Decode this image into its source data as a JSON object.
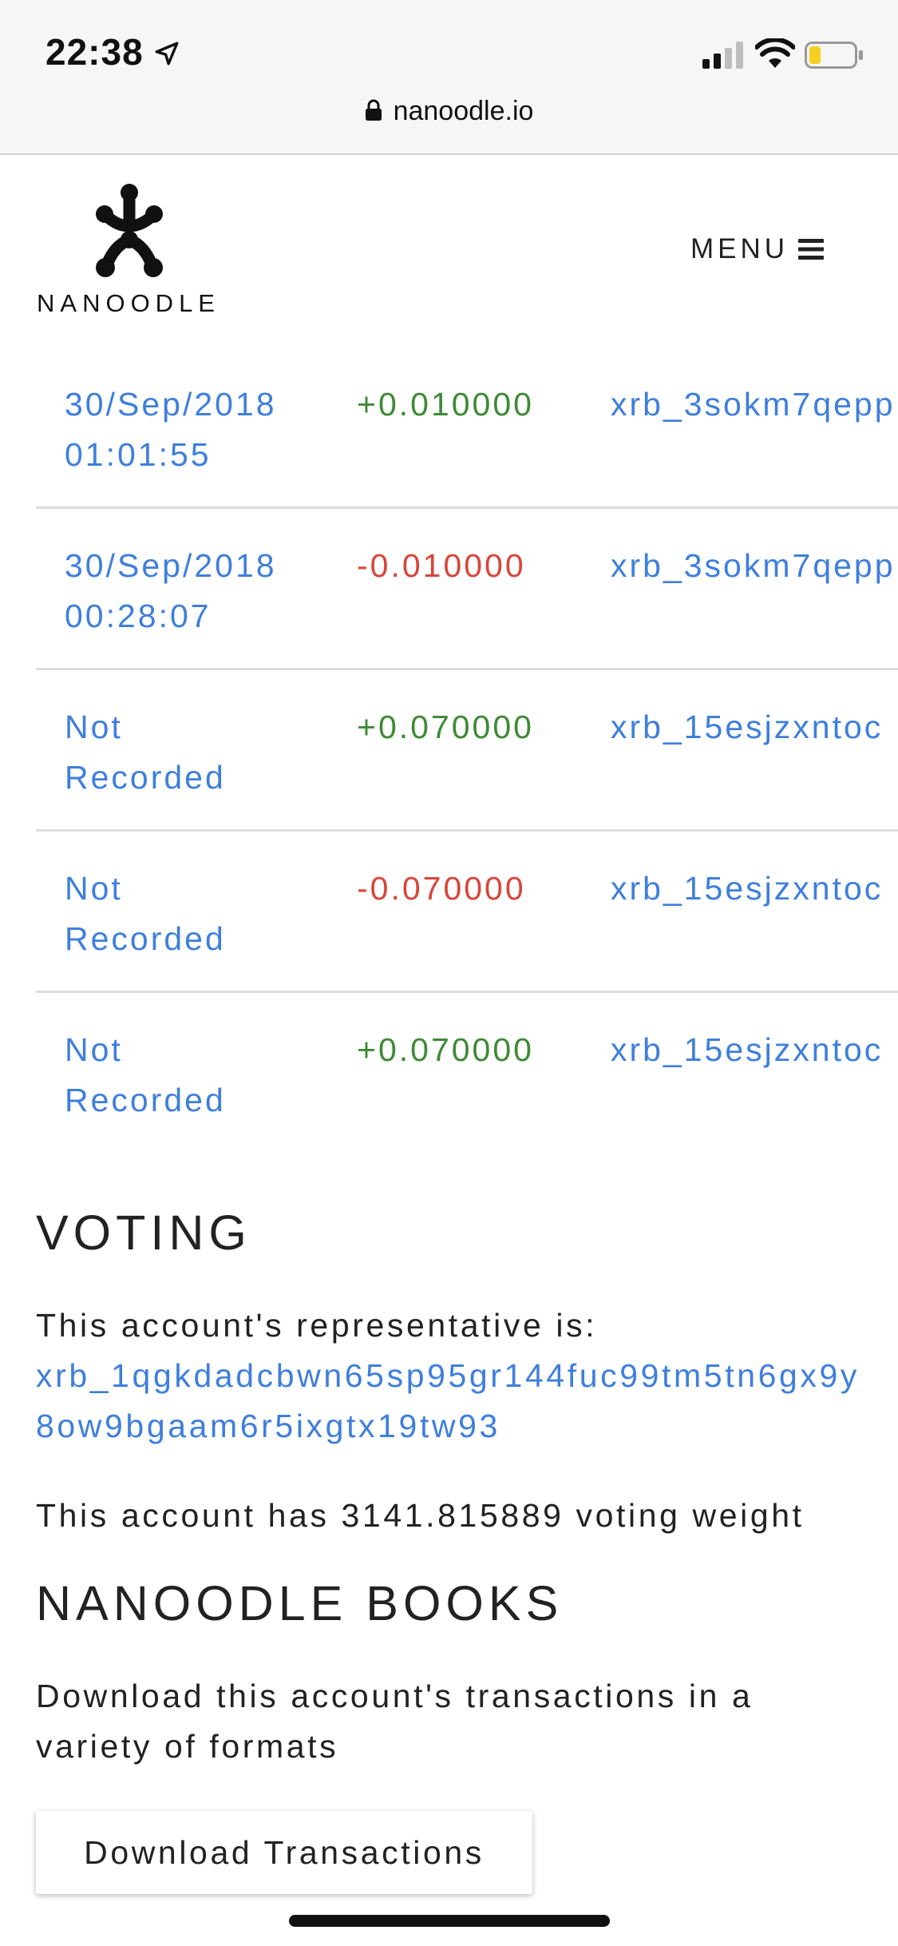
{
  "status_bar": {
    "time": "22:38"
  },
  "browser": {
    "url": "nanoodle.io"
  },
  "header": {
    "logo_text": "NANOODLE",
    "menu_label": "MENU"
  },
  "transactions": [
    {
      "date_line1": "30/Sep/2018",
      "date_line2": "01:01:55",
      "amount": "+0.010000",
      "direction": "positive",
      "account": "xrb_3sokm7qepp"
    },
    {
      "date_line1": "30/Sep/2018",
      "date_line2": "00:28:07",
      "amount": "-0.010000",
      "direction": "negative",
      "account": "xrb_3sokm7qepp"
    },
    {
      "date_line1": "Not",
      "date_line2": "Recorded",
      "amount": "+0.070000",
      "direction": "positive",
      "account": "xrb_15esjzxntoc"
    },
    {
      "date_line1": "Not",
      "date_line2": "Recorded",
      "amount": "-0.070000",
      "direction": "negative",
      "account": "xrb_15esjzxntoc"
    },
    {
      "date_line1": "Not",
      "date_line2": "Recorded",
      "amount": "+0.070000",
      "direction": "positive",
      "account": "xrb_15esjzxntoc"
    }
  ],
  "voting": {
    "title": "VOTING",
    "representative_label": "This account's representative is:",
    "representative_address": "xrb_1qgkdadcbwn65sp95gr144fuc99tm5tn6gx9y8ow9bgaam6r5ixgtx19tw93",
    "weight_text": "This account has 3141.815889 voting weight"
  },
  "books": {
    "title": "NANOODLE BOOKS",
    "description": "Download this account's transactions in a variety of formats",
    "download_label": "Download Transactions"
  },
  "colors": {
    "link": "#3f7fdc",
    "positive": "#3e8a35",
    "negative": "#d8453a"
  }
}
